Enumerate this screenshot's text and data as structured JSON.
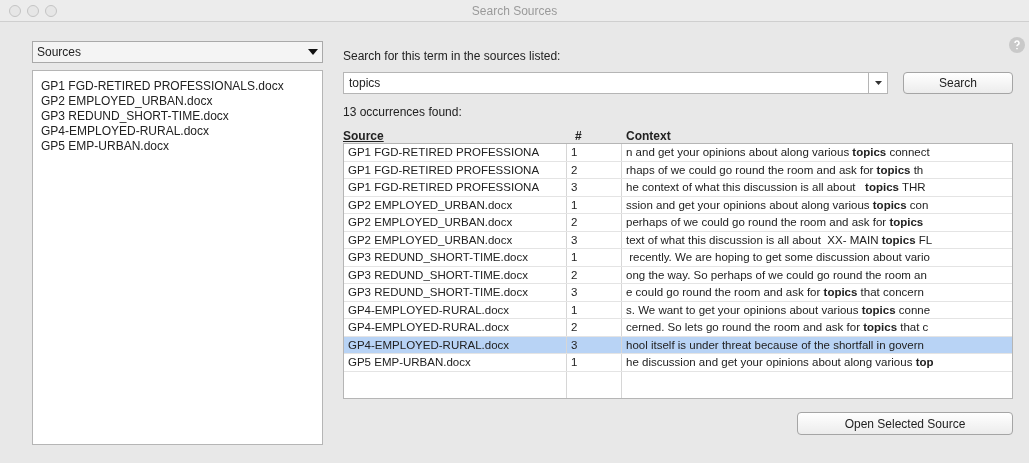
{
  "window": {
    "title": "Search Sources"
  },
  "scope_dropdown": {
    "value": "Sources"
  },
  "source_list": [
    "GP1 FGD-RETIRED PROFESSIONALS.docx",
    "GP2 EMPLOYED_URBAN.docx",
    "GP3 REDUND_SHORT-TIME.docx",
    "GP4-EMPLOYED-RURAL.docx",
    "GP5 EMP-URBAN.docx"
  ],
  "search_label": "Search for this term in the sources listed:",
  "search_field": {
    "value": "topics"
  },
  "search_button": "Search",
  "result_count": "13 occurrences found:",
  "table": {
    "columns": [
      "Source",
      "#",
      "Context"
    ],
    "rows": [
      {
        "source": "GP1 FGD-RETIRED PROFESSIONA",
        "number": "1",
        "context": "n and get your opinions about along various **topics** connect",
        "selected": false
      },
      {
        "source": "GP1 FGD-RETIRED PROFESSIONA",
        "number": "2",
        "context": "rhaps of we could go round the room and ask for **topics** th",
        "selected": false
      },
      {
        "source": "GP1 FGD-RETIRED PROFESSIONA",
        "number": "3",
        "context": "he context of what this discussion is all about   **topics** THR",
        "selected": false
      },
      {
        "source": "GP2 EMPLOYED_URBAN.docx",
        "number": "1",
        "context": "ssion and get your opinions about along various **topics** con",
        "selected": false
      },
      {
        "source": "GP2 EMPLOYED_URBAN.docx",
        "number": "2",
        "context": "perhaps of we could go round the room and ask for **topics**",
        "selected": false
      },
      {
        "source": "GP2 EMPLOYED_URBAN.docx",
        "number": "3",
        "context": "text of what this discussion is all about  XX- MAIN **topics** FL",
        "selected": false
      },
      {
        "source": "GP3 REDUND_SHORT-TIME.docx",
        "number": "1",
        "context": " recently. We are hoping to get some discussion about vario",
        "selected": false
      },
      {
        "source": "GP3 REDUND_SHORT-TIME.docx",
        "number": "2",
        "context": "ong the way. So perhaps of we could go round the room an",
        "selected": false
      },
      {
        "source": "GP3 REDUND_SHORT-TIME.docx",
        "number": "3",
        "context": "e could go round the room and ask for **topics** that concern",
        "selected": false
      },
      {
        "source": "GP4-EMPLOYED-RURAL.docx",
        "number": "1",
        "context": "s. We want to get your opinions about various **topics** conne",
        "selected": false
      },
      {
        "source": "GP4-EMPLOYED-RURAL.docx",
        "number": "2",
        "context": "cerned. So lets go round the room and ask for **topics** that c",
        "selected": false
      },
      {
        "source": "GP4-EMPLOYED-RURAL.docx",
        "number": "3",
        "context": "hool itself is under threat because of the shortfall in govern",
        "selected": true
      },
      {
        "source": "GP5 EMP-URBAN.docx",
        "number": "1",
        "context": "he discussion and get your opinions about along various **top**",
        "selected": false
      }
    ]
  },
  "open_button": "Open Selected Source"
}
